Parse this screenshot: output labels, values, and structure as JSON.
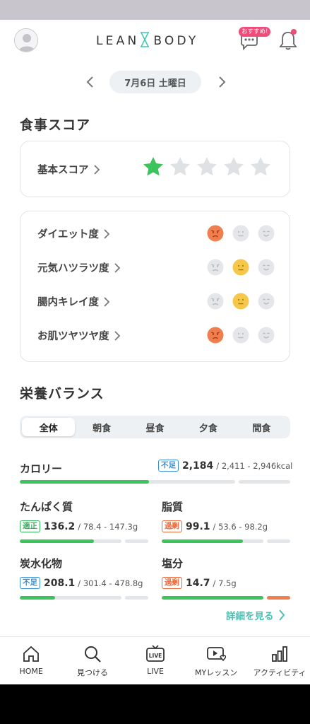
{
  "header": {
    "logo_left": "LEAN",
    "logo_right": "BODY",
    "chat_badge": "おすすめ!"
  },
  "date": {
    "label": "7月6日 土曜日"
  },
  "meal_score": {
    "title": "食事スコア",
    "basic_label": "基本スコア",
    "stars_filled": 1,
    "stars_total": 5,
    "metrics": [
      {
        "label": "ダイエット度",
        "selected": "bad"
      },
      {
        "label": "元気ハツラツ度",
        "selected": "neutral"
      },
      {
        "label": "腸内キレイ度",
        "selected": "neutral"
      },
      {
        "label": "お肌ツヤツヤ度",
        "selected": "bad"
      }
    ]
  },
  "nutrition": {
    "title": "栄養バランス",
    "tabs": [
      "全体",
      "朝食",
      "昼食",
      "夕食",
      "間食"
    ],
    "active_tab": 0,
    "calorie": {
      "label": "カロリー",
      "status": "不足",
      "value": "2,184",
      "range": "/ 2,411 - 2,946kcal",
      "progress": 0.6
    },
    "items": [
      {
        "label": "たんぱく質",
        "status": "適正",
        "status_type": "ok",
        "value": "136.2",
        "range": "/ 78.4 - 147.3g",
        "progress": 0.73
      },
      {
        "label": "脂質",
        "status": "過剰",
        "status_type": "over",
        "value": "99.1",
        "range": "/ 53.6 - 98.2g",
        "progress": 0.8
      },
      {
        "label": "炭水化物",
        "status": "不足",
        "status_type": "under",
        "value": "208.1",
        "range": "/ 301.4 - 478.8g",
        "progress": 0.35
      },
      {
        "label": "塩分",
        "status": "過剰",
        "status_type": "over",
        "value": "14.7",
        "range": "/ 7.5g",
        "progress": 1.0
      }
    ],
    "more_link": "詳細を見る"
  },
  "bottom_nav": [
    {
      "label": "HOME",
      "icon": "home-icon"
    },
    {
      "label": "見つける",
      "icon": "search-icon"
    },
    {
      "label": "LIVE",
      "icon": "live-tv-icon"
    },
    {
      "label": "MYレッスン",
      "icon": "my-lesson-icon"
    },
    {
      "label": "アクティビティ",
      "icon": "activity-icon"
    }
  ],
  "colors": {
    "green": "#3cc45c",
    "star": "#3cc45c",
    "orange": "#f07f4f",
    "yellow": "#f5c84b",
    "teal": "#4fc0b4",
    "pink": "#ef4c7a"
  }
}
